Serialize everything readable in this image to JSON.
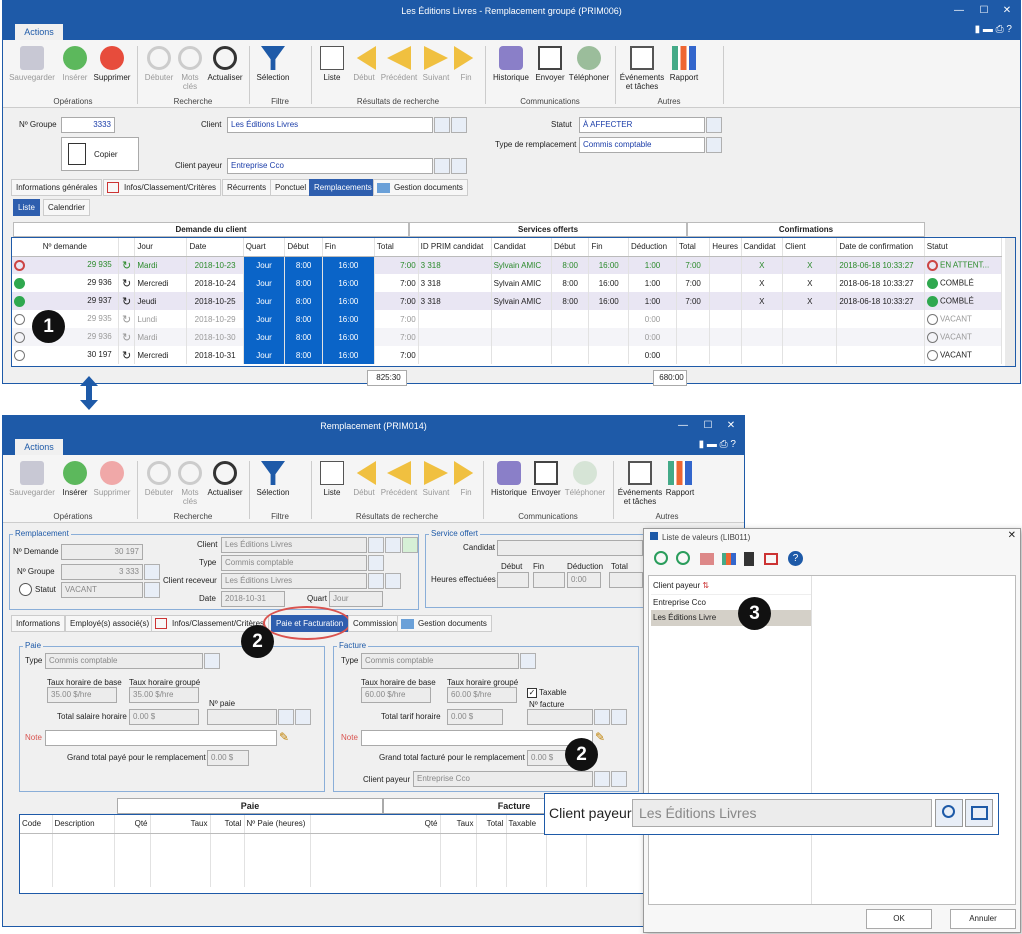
{
  "win1": {
    "title": "Les Éditions Livres - Remplacement groupé (PRIM006)",
    "actions_tab": "Actions",
    "ribbon": {
      "save": "Sauvegarder",
      "insert": "Insérer",
      "delete": "Supprimer",
      "begin": "Débuter",
      "keywords": "Mots clés",
      "refresh": "Actualiser",
      "selection": "Sélection",
      "list": "Liste",
      "start": "Début",
      "prev": "Précédent",
      "next": "Suivant",
      "end": "Fin",
      "history": "Historique",
      "send": "Envoyer",
      "phone": "Téléphoner",
      "events": "Événements et tâches",
      "report": "Rapport",
      "groups": {
        "ops": "Opérations",
        "search": "Recherche",
        "filter": "Filtre",
        "results": "Résultats de recherche",
        "comm": "Communications",
        "other": "Autres"
      }
    },
    "form": {
      "group_label": "Nº Groupe",
      "group_value": "3333",
      "copy": "Copier",
      "client_label": "Client",
      "client_value": "Les Éditions Livres",
      "payer_label": "Client payeur",
      "payer_value": "Entreprise Cco",
      "status_label": "Statut",
      "status_value": "À AFFECTER",
      "type_label": "Type de remplacement",
      "type_value": "Commis comptable"
    },
    "tabs": [
      "Informations générales",
      "Infos/Classement/Critères",
      "Récurrents",
      "Ponctuel",
      "Remplacements",
      "Gestion documents"
    ],
    "subtabs": [
      "Liste",
      "Calendrier"
    ],
    "groups": {
      "demand": "Demande du client",
      "services": "Services offerts",
      "confirm": "Confirmations"
    },
    "headers": [
      "Nº demande",
      "",
      "Jour",
      "Date",
      "Quart",
      "Début",
      "Fin",
      "Total",
      "ID PRIM candidat",
      "Candidat",
      "Début",
      "Fin",
      "Déduction",
      "Total",
      "Heures",
      "Candidat",
      "Client",
      "Date de confirmation",
      "Statut"
    ],
    "rows": [
      {
        "num": "29 935",
        "jour": "Mardi",
        "date": "2018-10-23",
        "quart": "Jour",
        "debut": "8:00",
        "fin": "16:00",
        "total": "7:00",
        "id": "3 318",
        "cand": "Sylvain AMIC",
        "d2": "8:00",
        "f2": "16:00",
        "ded": "1:00",
        "t2": "7:00",
        "h": "",
        "cc": "X",
        "cl": "X",
        "dc": "2018-06-18 10:33:27",
        "statut": "EN ATTENT...",
        "style": "green"
      },
      {
        "num": "29 936",
        "jour": "Mercredi",
        "date": "2018-10-24",
        "quart": "Jour",
        "debut": "8:00",
        "fin": "16:00",
        "total": "7:00",
        "id": "3 318",
        "cand": "Sylvain AMIC",
        "d2": "8:00",
        "f2": "16:00",
        "ded": "1:00",
        "t2": "7:00",
        "h": "",
        "cc": "X",
        "cl": "X",
        "dc": "2018-06-18 10:33:27",
        "statut": "COMBLÉ",
        "style": "normal"
      },
      {
        "num": "29 937",
        "jour": "Jeudi",
        "date": "2018-10-25",
        "quart": "Jour",
        "debut": "8:00",
        "fin": "16:00",
        "total": "7:00",
        "id": "3 318",
        "cand": "Sylvain AMIC",
        "d2": "8:00",
        "f2": "16:00",
        "ded": "1:00",
        "t2": "7:00",
        "h": "",
        "cc": "X",
        "cl": "X",
        "dc": "2018-06-18 10:33:27",
        "statut": "COMBLÉ",
        "style": "normal"
      },
      {
        "num": "29 935",
        "jour": "Lundi",
        "date": "2018-10-29",
        "quart": "Jour",
        "debut": "8:00",
        "fin": "16:00",
        "total": "7:00",
        "id": "",
        "cand": "",
        "d2": "",
        "f2": "",
        "ded": "0:00",
        "t2": "",
        "h": "",
        "cc": "",
        "cl": "",
        "dc": "",
        "statut": "VACANT",
        "style": "grey"
      },
      {
        "num": "29 936",
        "jour": "Mardi",
        "date": "2018-10-30",
        "quart": "Jour",
        "debut": "8:00",
        "fin": "16:00",
        "total": "7:00",
        "id": "",
        "cand": "",
        "d2": "",
        "f2": "",
        "ded": "0:00",
        "t2": "",
        "h": "",
        "cc": "",
        "cl": "",
        "dc": "",
        "statut": "VACANT",
        "style": "grey"
      },
      {
        "num": "30 197",
        "jour": "Mercredi",
        "date": "2018-10-31",
        "quart": "Jour",
        "debut": "8:00",
        "fin": "16:00",
        "total": "7:00",
        "id": "",
        "cand": "",
        "d2": "",
        "f2": "",
        "ded": "0:00",
        "t2": "",
        "h": "",
        "cc": "",
        "cl": "",
        "dc": "",
        "statut": "VACANT",
        "style": "edit"
      }
    ],
    "totals": {
      "demand": "825:30",
      "services": "680:00"
    }
  },
  "win2": {
    "title": "Remplacement (PRIM014)",
    "actions_tab": "Actions",
    "ribbon": {
      "save": "Sauvegarder",
      "insert": "Insérer",
      "delete": "Supprimer",
      "begin": "Débuter",
      "keywords": "Mots clés",
      "refresh": "Actualiser",
      "selection": "Sélection",
      "list": "Liste",
      "start": "Début",
      "prev": "Précédent",
      "next": "Suivant",
      "end": "Fin",
      "history": "Historique",
      "send": "Envoyer",
      "phone": "Téléphoner",
      "events": "Événements et tâches",
      "report": "Rapport",
      "groups": {
        "ops": "Opérations",
        "search": "Recherche",
        "filter": "Filtre",
        "results": "Résultats de recherche",
        "comm": "Communications",
        "other": "Autres"
      }
    },
    "remp": {
      "legend": "Remplacement",
      "num_label": "Nº Demande",
      "num_value": "30 197",
      "group_label": "Nº Groupe",
      "group_value": "3 333",
      "status_label": "Statut",
      "status_value": "VACANT",
      "client_label": "Client",
      "client_value": "Les Éditions Livres",
      "type_label": "Type",
      "type_value": "Commis comptable",
      "recv_label": "Client receveur",
      "recv_value": "Les Éditions Livres",
      "date_label": "Date",
      "date_value": "2018-10-31",
      "shift_label": "Quart",
      "shift_value": "Jour"
    },
    "service": {
      "legend": "Service offert",
      "cand_label": "Candidat",
      "hours_label": "Heures effectuées",
      "debut": "Début",
      "fin": "Fin",
      "ded": "Déduction",
      "total": "Total",
      "ded_value": "0:00"
    },
    "tabs": [
      "Informations",
      "Employé(s) associé(s)",
      "Infos/Classement/Critères",
      "Paie et Facturation",
      "Commission",
      "Gestion documents"
    ],
    "paie": {
      "legend": "Paie",
      "type_label": "Type",
      "type_value": "Commis comptable",
      "base_label": "Taux horaire de base",
      "base_value": "35.00 $/hre",
      "grp_label": "Taux horaire groupé",
      "grp_value": "35.00 $/hre",
      "npaie_label": "Nº paie",
      "total_label": "Total salaire horaire",
      "total_value": "0.00 $",
      "note_label": "Note",
      "grand_label": "Grand total payé pour le remplacement",
      "grand_value": "0.00 $"
    },
    "facture": {
      "legend": "Facture",
      "type_label": "Type",
      "type_value": "Commis comptable",
      "base_label": "Taux horaire de base",
      "base_value": "60.00 $/hre",
      "grp_label": "Taux horaire groupé",
      "grp_value": "60.00 $/hre",
      "taxable": "Taxable",
      "nfact_label": "Nº facture",
      "total_label": "Total tarif horaire",
      "total_value": "0.00 $",
      "note_label": "Note",
      "grand_label": "Grand total facturé pour le remplacement",
      "grand_value": "0.00 $",
      "payer_label": "Client payeur",
      "payer_value": "Entreprise Cco"
    },
    "bottom": {
      "paie": "Paie",
      "facture": "Facture",
      "cols": [
        "Code",
        "Description",
        "Qté",
        "Taux",
        "Total",
        "Nº Paie (heures)",
        "Qté",
        "Taux",
        "Total",
        "Taxable"
      ]
    }
  },
  "win3": {
    "title": "Liste de valeurs (LIB011)",
    "header": "Client payeur",
    "items": [
      "Entreprise Cco",
      "Les Éditions Livre"
    ],
    "ok": "OK",
    "cancel": "Annuler"
  },
  "callout": {
    "label": "Client payeur",
    "value": "Les Éditions Livres"
  },
  "badges": [
    "1",
    "2",
    "2",
    "3"
  ],
  "colors": {
    "title": "#1e5aa8",
    "selected_blue": "#0a64c8",
    "tab_selected": "#2e5eae",
    "highlight_red": "#d9534f"
  }
}
